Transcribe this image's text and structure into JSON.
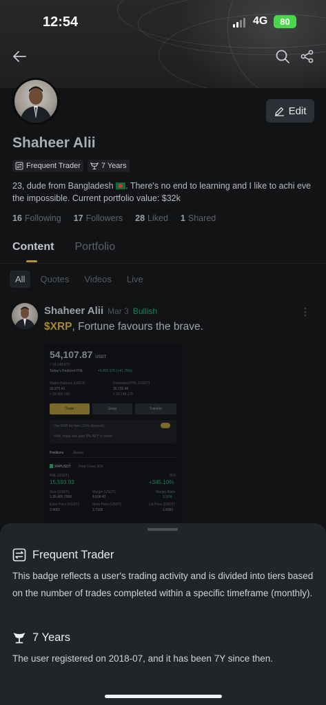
{
  "status_bar": {
    "time": "12:54",
    "network": "4G",
    "battery": "80"
  },
  "profile": {
    "name": "Shaheer Alii",
    "edit_label": "Edit",
    "badges": [
      {
        "icon": "trade-badge-icon",
        "label": "Frequent Trader"
      },
      {
        "icon": "trophy-icon",
        "label": "7 Years"
      }
    ],
    "bio_part1": "23, dude from Bangladesh",
    "bio_part2": ". There's no end to learning and I like to achi eve the impossible. Current portfolio value: $32k",
    "stats": [
      {
        "count": "16",
        "label": "Following"
      },
      {
        "count": "17",
        "label": "Followers"
      },
      {
        "count": "28",
        "label": "Liked"
      },
      {
        "count": "1",
        "label": "Shared"
      }
    ]
  },
  "tabs": [
    {
      "label": "Content"
    },
    {
      "label": "Portfolio"
    }
  ],
  "filters": [
    {
      "label": "All"
    },
    {
      "label": "Quotes"
    },
    {
      "label": "Videos"
    },
    {
      "label": "Live"
    }
  ],
  "post": {
    "author": "Shaheer Alii",
    "date": "Mar 3",
    "sentiment": "Bullish",
    "ticker": "$XRP",
    "text": ", Fortune favours the brave.",
    "image": {
      "total": "54,107.87",
      "unit": "USDT",
      "sub_total": "≈ 54,148.675",
      "realized_label": "Today's Realized PNL",
      "realized_value": "+5,831.575 (+41.75%)",
      "wallet_label": "Wallet Balance (USDT)",
      "wallet_value": "33,375.41",
      "wallet_sub": "≈ 33,400.795",
      "unrealized_label": "Unrealized PNL (USDT)",
      "unrealized_value": "20,732.46",
      "unrealized_sub": "≈ 20,748.175",
      "btn_trade": "Trade",
      "btn_swap": "Swap",
      "btn_transfer": "Transfer",
      "bnb_text": "Use BNB for fees (10% discount)",
      "hold_text": "Hold, trade and earn 8% APY or more!",
      "tab_positions": "Positions",
      "tab_assets": "Assets",
      "symbol": "XRPUSDT",
      "sym_tags": "Perp   Cross 20X",
      "pnl_label": "PNL (USDT)",
      "pnl_value": "15,593.93",
      "roi_label": "ROI",
      "roi_value": "+345.10%",
      "size_label": "Size (USDT)",
      "size_value": "1,35,420.7260",
      "margin_label": "Margin (USDT)",
      "margin_value": "4,518.42",
      "ratio_label": "Margin Ratio",
      "ratio_value": "3.16%",
      "entry_label": "Entry Price (USDT)",
      "entry_value": "2.4051",
      "mark_label": "Mark Price (USDT)",
      "mark_value": "2.7155",
      "liq_label": "Liq Price (USDT)",
      "liq_value": "1.6561"
    }
  },
  "sheet": {
    "trader_title": "Frequent Trader",
    "trader_text": "This badge reflects a user's trading activity and is divided into tiers based on the number of trades completed within a specific timeframe (monthly).",
    "years_title": "7 Years",
    "years_text": "The user registered on 2018-07, and it has been 7Y since then."
  },
  "colors": {
    "accent": "#b8962e",
    "bullish": "#1e7c55",
    "battery": "#4ad64a"
  }
}
